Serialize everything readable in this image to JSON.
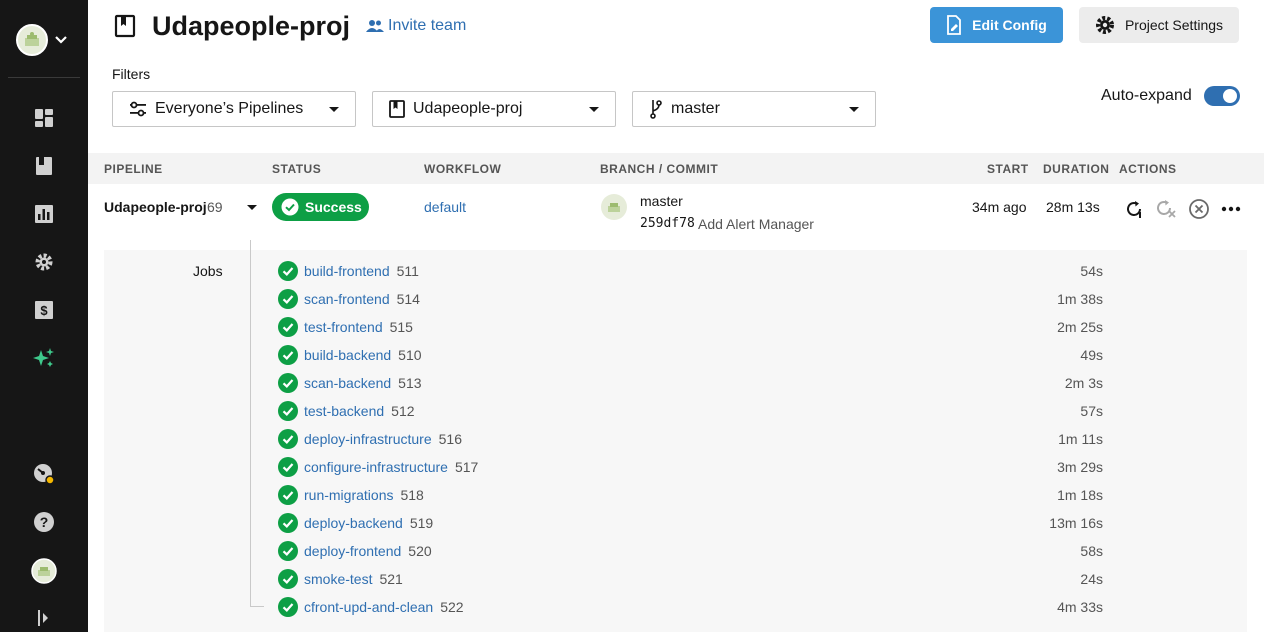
{
  "header": {
    "project_name": "Udapeople-proj",
    "invite_label": "Invite team",
    "edit_config_label": "Edit Config",
    "project_settings_label": "Project Settings"
  },
  "filters": {
    "label": "Filters",
    "pipelines": "Everyone’s Pipelines",
    "project": "Udapeople-proj",
    "branch": "master",
    "auto_expand_label": "Auto-expand",
    "auto_expand_on": true
  },
  "table": {
    "headers": {
      "pipeline": "PIPELINE",
      "status": "STATUS",
      "workflow": "WORKFLOW",
      "branch_commit": "BRANCH / COMMIT",
      "start": "START",
      "duration": "DURATION",
      "actions": "ACTIONS"
    },
    "pipeline_row": {
      "pipeline_name": "Udapeople-proj",
      "pipeline_number": "69",
      "status": "Success",
      "workflow": "default",
      "branch": "master",
      "commit_hash": "259df78",
      "commit_message": "Add Alert Manager",
      "start": "34m ago",
      "duration": "28m 13s"
    }
  },
  "jobs": {
    "label": "Jobs",
    "items": [
      {
        "name": "build-frontend",
        "number": "511",
        "duration": "54s"
      },
      {
        "name": "scan-frontend",
        "number": "514",
        "duration": "1m 38s"
      },
      {
        "name": "test-frontend",
        "number": "515",
        "duration": "2m 25s"
      },
      {
        "name": "build-backend",
        "number": "510",
        "duration": "49s"
      },
      {
        "name": "scan-backend",
        "number": "513",
        "duration": "2m 3s"
      },
      {
        "name": "test-backend",
        "number": "512",
        "duration": "57s"
      },
      {
        "name": "deploy-infrastructure",
        "number": "516",
        "duration": "1m 11s"
      },
      {
        "name": "configure-infrastructure",
        "number": "517",
        "duration": "3m 29s"
      },
      {
        "name": "run-migrations",
        "number": "518",
        "duration": "1m 18s"
      },
      {
        "name": "deploy-backend",
        "number": "519",
        "duration": "13m 16s"
      },
      {
        "name": "deploy-frontend",
        "number": "520",
        "duration": "58s"
      },
      {
        "name": "smoke-test",
        "number": "521",
        "duration": "24s"
      },
      {
        "name": "cfront-upd-and-clean",
        "number": "522",
        "duration": "4m 33s"
      }
    ]
  },
  "colors": {
    "sidebar": "#161616",
    "success": "#0d9f45",
    "link": "#2f6fb1",
    "primary_button": "#3b94d8",
    "active_nav": "#3ec98b"
  },
  "sidebar": {
    "icons": [
      "dashboard-icon",
      "projects-icon",
      "insights-icon",
      "settings-icon",
      "plan-icon",
      "whats-new-icon",
      "status-icon",
      "help-icon",
      "user-avatar",
      "collapse-icon"
    ]
  }
}
